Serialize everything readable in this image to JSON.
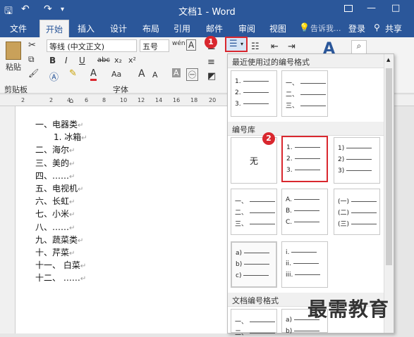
{
  "window": {
    "title": "文档1 - Word",
    "restore_icon": "restore-icon",
    "minimize": "—",
    "maximize": "□"
  },
  "quick_access": {
    "save": "🖫",
    "undo": "↶",
    "redo": "↷",
    "more": "▾"
  },
  "tabs": [
    "文件",
    "开始",
    "插入",
    "设计",
    "布局",
    "引用",
    "邮件",
    "审阅",
    "视图"
  ],
  "tell_me": "告诉我...",
  "login": "登录",
  "share": "共享",
  "ribbon": {
    "paste": "粘贴",
    "clipboard": "剪贴板",
    "font_name": "等线 (中文正文)",
    "font_size": "五号",
    "font_group": "字体",
    "wen": "wén",
    "A_btn": "A",
    "bold": "B",
    "italic": "I",
    "underline": "U",
    "strike": "abc",
    "sub": "x₂",
    "sup": "x²",
    "aa": "Aa",
    "grow": "A",
    "shrink": "A",
    "clear": "A"
  },
  "ruler_ticks": [
    "2",
    "2",
    "4",
    "6",
    "8",
    "10",
    "12",
    "14",
    "16",
    "18",
    "20"
  ],
  "document": [
    {
      "text": "一、电器类",
      "indent": 1
    },
    {
      "text": "1.  冰箱",
      "indent": 3
    },
    {
      "text": "二、海尔",
      "indent": 1
    },
    {
      "text": "三、美的",
      "indent": 1
    },
    {
      "text": "四、……",
      "indent": 1
    },
    {
      "text": "五、电视机",
      "indent": 1
    },
    {
      "text": "六、长虹",
      "indent": 1
    },
    {
      "text": "七、小米",
      "indent": 1
    },
    {
      "text": "八、……",
      "indent": 1
    },
    {
      "text": "九、蔬菜类",
      "indent": 1
    },
    {
      "text": "十、芹菜",
      "indent": 1
    },
    {
      "text": "十一、   白菜",
      "indent": 1
    },
    {
      "text": "十二、   ……",
      "indent": 1
    }
  ],
  "dropdown": {
    "recent_header": "最近使用过的编号格式",
    "library_header": "编号库",
    "doc_header": "文档编号格式",
    "none_label": "无",
    "recent": [
      [
        "1.",
        "2.",
        "3."
      ],
      [
        "一、",
        "二、",
        "三、"
      ]
    ],
    "library": [
      [
        "1.",
        "2.",
        "3."
      ],
      [
        "1)",
        "2)",
        "3)"
      ],
      [
        "一、",
        "二、",
        "三、"
      ],
      [
        "A.",
        "B.",
        "C."
      ],
      [
        "(一)",
        "(二)",
        "(三)"
      ],
      [
        "a)",
        "b)",
        "c)"
      ],
      [
        "i.",
        "ii.",
        "iii."
      ]
    ],
    "doc": [
      [
        "一、",
        "二、"
      ],
      [
        "a)",
        "b)"
      ]
    ]
  },
  "badges": [
    "1",
    "2"
  ],
  "watermark": "最需教育",
  "colors": {
    "accent": "#2b579a",
    "highlight": "#d9272e"
  }
}
